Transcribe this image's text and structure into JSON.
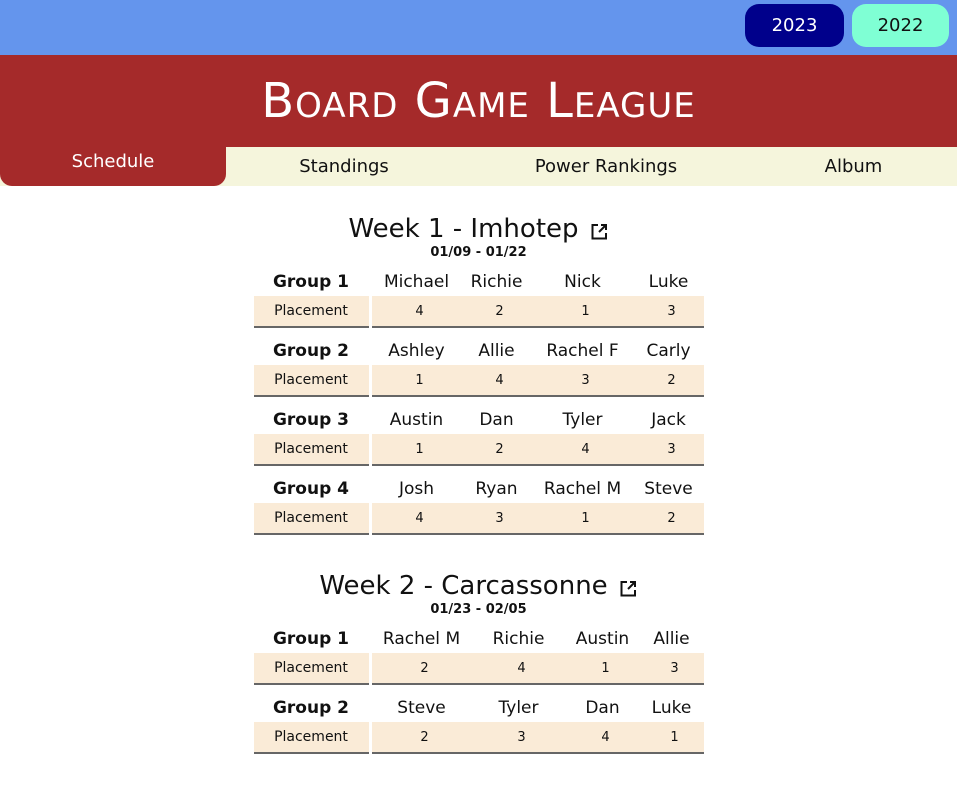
{
  "years": {
    "current": "2023",
    "previous": "2022"
  },
  "header": {
    "title": "Board Game League"
  },
  "nav": {
    "schedule": "Schedule",
    "standings": "Standings",
    "power": "Power Rankings",
    "album": "Album"
  },
  "colors": {
    "topbar": "#6495ed",
    "header": "#a52a2a",
    "nav": "#f5f5dc",
    "placement_bg": "#faebd7",
    "year_active": "#00008b",
    "year_other": "#7fffd4"
  },
  "icons": {
    "week_link": "external-link-icon"
  },
  "weeks": [
    {
      "title": "Week 1 - Imhotep",
      "dates": "01/09 - 01/22",
      "groups": [
        {
          "name": "Group 1",
          "label": "Placement",
          "players": [
            "Michael",
            "Richie",
            "Nick",
            "Luke"
          ],
          "placements": [
            "4",
            "2",
            "1",
            "3"
          ]
        },
        {
          "name": "Group 2",
          "label": "Placement",
          "players": [
            "Ashley",
            "Allie",
            "Rachel F",
            "Carly"
          ],
          "placements": [
            "1",
            "4",
            "3",
            "2"
          ]
        },
        {
          "name": "Group 3",
          "label": "Placement",
          "players": [
            "Austin",
            "Dan",
            "Tyler",
            "Jack"
          ],
          "placements": [
            "1",
            "2",
            "4",
            "3"
          ]
        },
        {
          "name": "Group 4",
          "label": "Placement",
          "players": [
            "Josh",
            "Ryan",
            "Rachel M",
            "Steve"
          ],
          "placements": [
            "4",
            "3",
            "1",
            "2"
          ]
        }
      ]
    },
    {
      "title": "Week 2 - Carcassonne",
      "dates": "01/23 - 02/05",
      "groups": [
        {
          "name": "Group 1",
          "label": "Placement",
          "players": [
            "Rachel M",
            "Richie",
            "Austin",
            "Allie"
          ],
          "placements": [
            "2",
            "4",
            "1",
            "3"
          ]
        },
        {
          "name": "Group 2",
          "label": "Placement",
          "players": [
            "Steve",
            "Tyler",
            "Dan",
            "Luke"
          ],
          "placements": [
            "2",
            "3",
            "4",
            "1"
          ]
        }
      ]
    }
  ]
}
